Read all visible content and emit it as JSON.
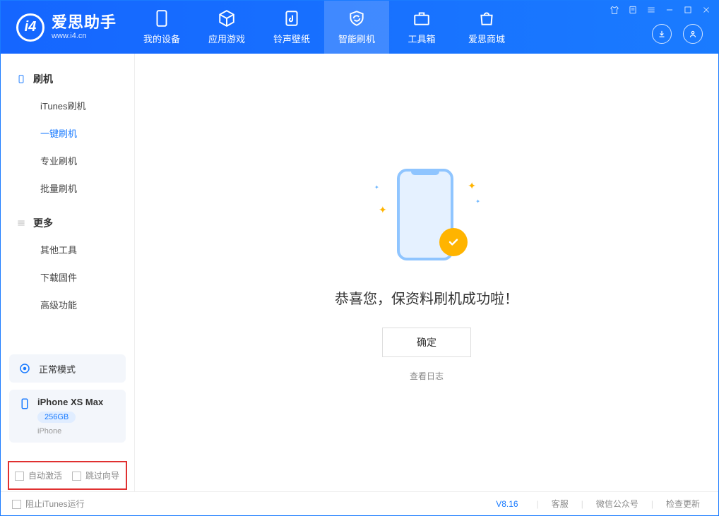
{
  "app": {
    "title": "爱思助手",
    "subtitle": "www.i4.cn"
  },
  "nav": {
    "device": "我的设备",
    "apps": "应用游戏",
    "ringtone": "铃声壁纸",
    "flash": "智能刷机",
    "toolbox": "工具箱",
    "store": "爱思商城"
  },
  "sidebar": {
    "flash_group": "刷机",
    "more_group": "更多",
    "items": {
      "itunes": "iTunes刷机",
      "oneclick": "一键刷机",
      "pro": "专业刷机",
      "batch": "批量刷机",
      "other": "其他工具",
      "firmware": "下载固件",
      "advanced": "高级功能"
    }
  },
  "device_panel": {
    "mode": "正常模式",
    "phone_name": "iPhone XS Max",
    "storage": "256GB",
    "phone_type": "iPhone"
  },
  "options": {
    "auto_activate": "自动激活",
    "skip_guide": "跳过向导"
  },
  "main": {
    "success_text": "恭喜您，保资料刷机成功啦！",
    "ok_button": "确定",
    "view_log": "查看日志"
  },
  "footer": {
    "block_itunes": "阻止iTunes运行",
    "version": "V8.16",
    "cs": "客服",
    "wechat": "微信公众号",
    "update": "检查更新"
  }
}
